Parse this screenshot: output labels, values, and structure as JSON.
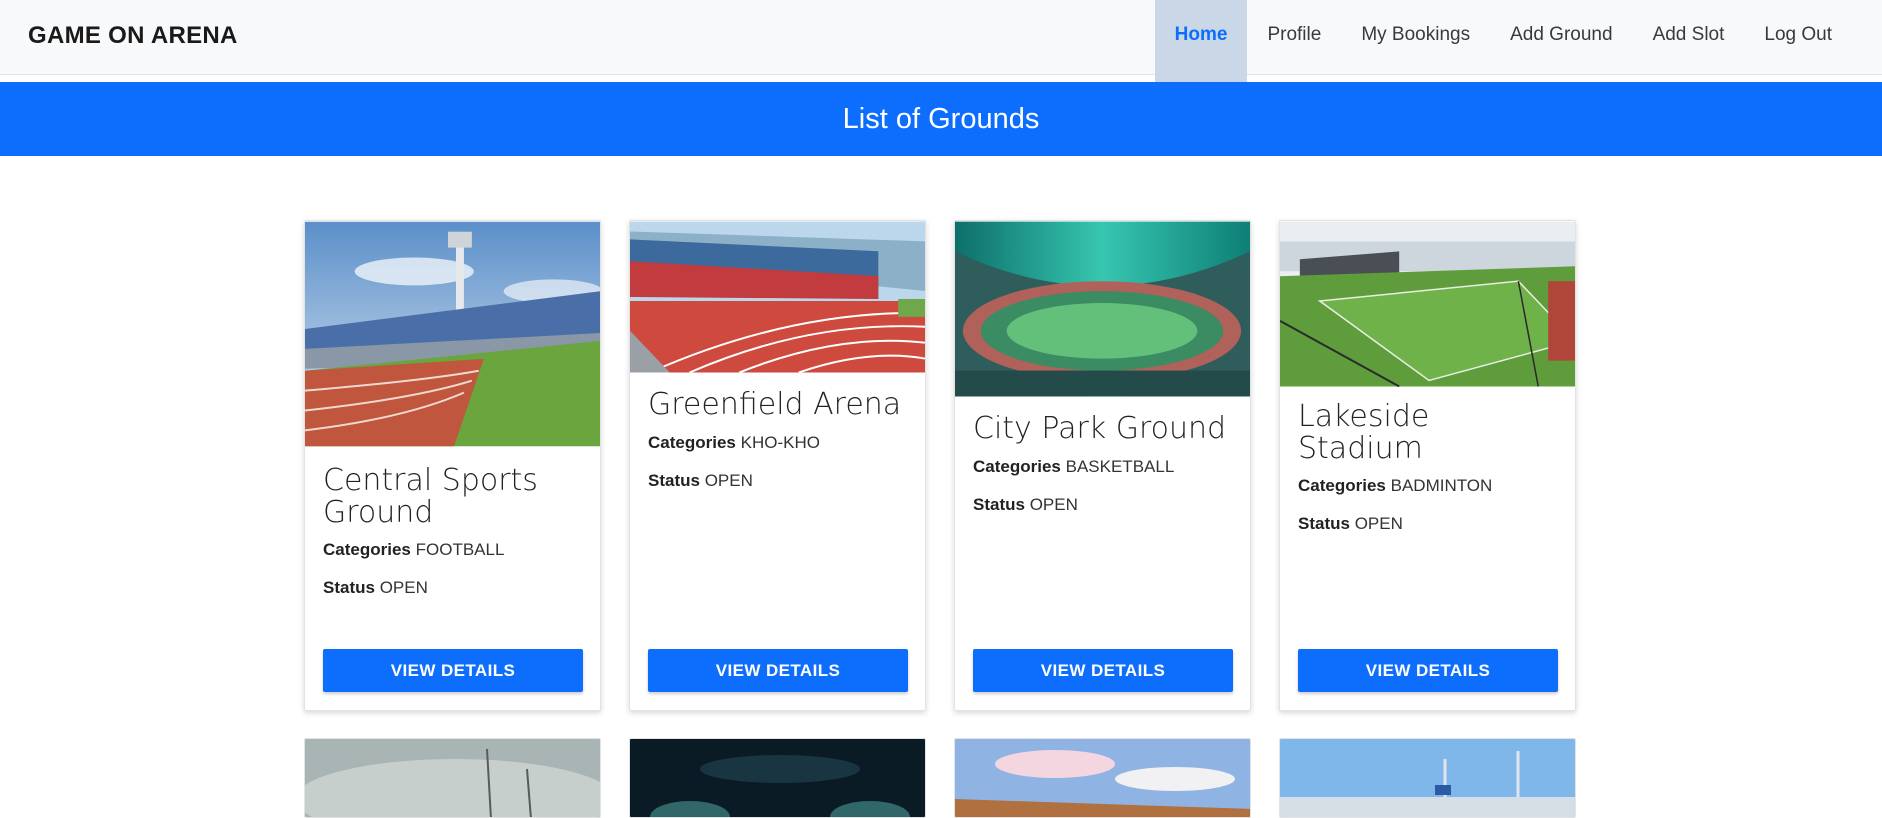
{
  "brand": "GAME ON ARENA",
  "nav": [
    {
      "label": "Home",
      "active": true
    },
    {
      "label": "Profile"
    },
    {
      "label": "My Bookings"
    },
    {
      "label": "Add Ground"
    },
    {
      "label": "Add Slot"
    },
    {
      "label": "Log Out"
    }
  ],
  "banner_title": "List of Grounds",
  "cards": [
    {
      "name": "Central Sports Ground",
      "categories_label": "Categories",
      "category": "FOOTBALL",
      "status_label": "Status",
      "status": "OPEN",
      "button": "VIEW DETAILS"
    },
    {
      "name": "Greenfield Arena",
      "categories_label": "Categories",
      "category": "KHO-KHO",
      "status_label": "Status",
      "status": "OPEN",
      "button": "VIEW DETAILS"
    },
    {
      "name": "City Park Ground",
      "categories_label": "Categories",
      "category": "BASKETBALL",
      "status_label": "Status",
      "status": "OPEN",
      "button": "VIEW DETAILS"
    },
    {
      "name": "Lakeside Stadium",
      "categories_label": "Categories",
      "category": "BADMINTON",
      "status_label": "Status",
      "status": "OPEN",
      "button": "VIEW DETAILS"
    }
  ],
  "colors": {
    "primary": "#0d6efd",
    "navbar_bg": "#f8f9fa",
    "active_nav_bg": "#c9d7e6"
  }
}
